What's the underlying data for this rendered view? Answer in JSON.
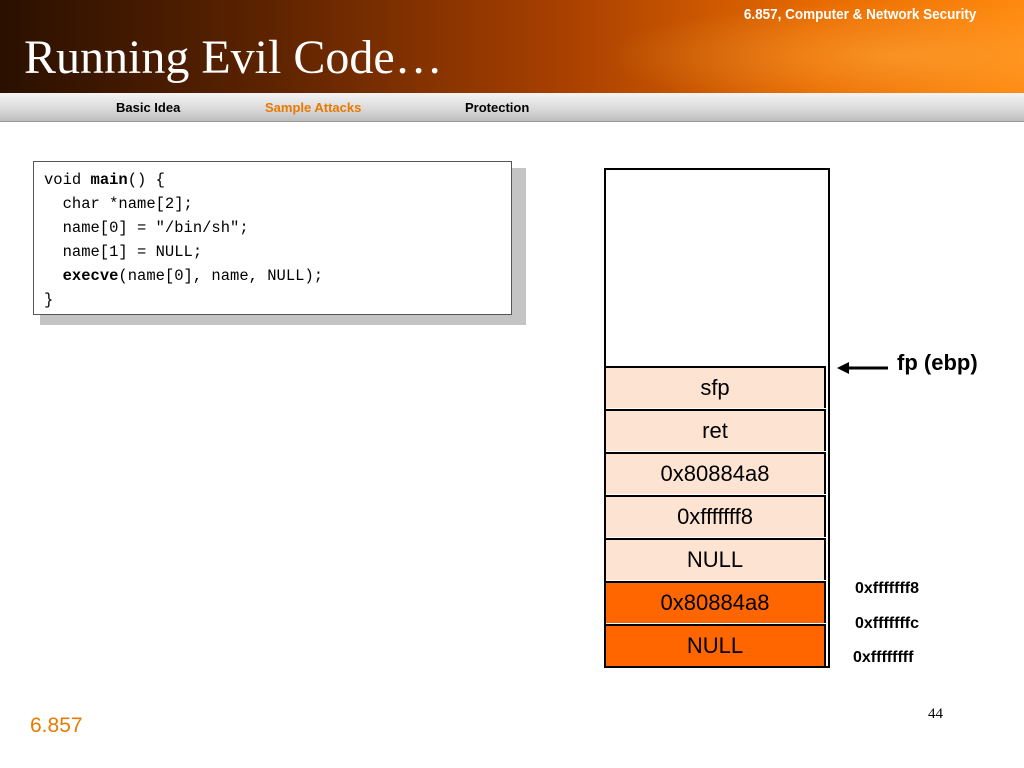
{
  "header": {
    "course": "6.857, Computer & Network Security",
    "title": "Running Evil Code…"
  },
  "nav": {
    "items": [
      {
        "label": "Basic Idea",
        "active": false
      },
      {
        "label": "Sample Attacks",
        "active": true
      },
      {
        "label": "Protection",
        "active": false
      }
    ]
  },
  "code": {
    "line1_a": "void ",
    "line1_fn": "main",
    "line1_b": "() {",
    "line2": "  char *name[2];",
    "line3": "  name[0] = \"/bin/sh\";",
    "line4": "  name[1] = NULL;",
    "line5_pre": "  ",
    "line5_fn": "execve",
    "line5_b": "(name[0], name, NULL);",
    "line6": "}"
  },
  "stack": {
    "cells": [
      {
        "label": "sfp",
        "highlight": false
      },
      {
        "label": "ret",
        "highlight": false
      },
      {
        "label": "0x80884a8",
        "highlight": false
      },
      {
        "label": "0xfffffff8",
        "highlight": false
      },
      {
        "label": "NULL",
        "highlight": false
      },
      {
        "label": "0x80884a8",
        "highlight": true
      },
      {
        "label": "NULL",
        "highlight": true
      }
    ],
    "pointer_label": "fp (ebp)",
    "addresses": [
      "0xfffffff8",
      "0xfffffffc",
      "0xffffffff"
    ],
    "colors": {
      "light": "#fde3d2",
      "dark": "#ff6600"
    }
  },
  "footer": {
    "label": "6.857",
    "page": "44"
  },
  "colors": {
    "accent": "#e87a00",
    "header_dark": "#2a1000",
    "header_bright": "#ff8a10"
  }
}
